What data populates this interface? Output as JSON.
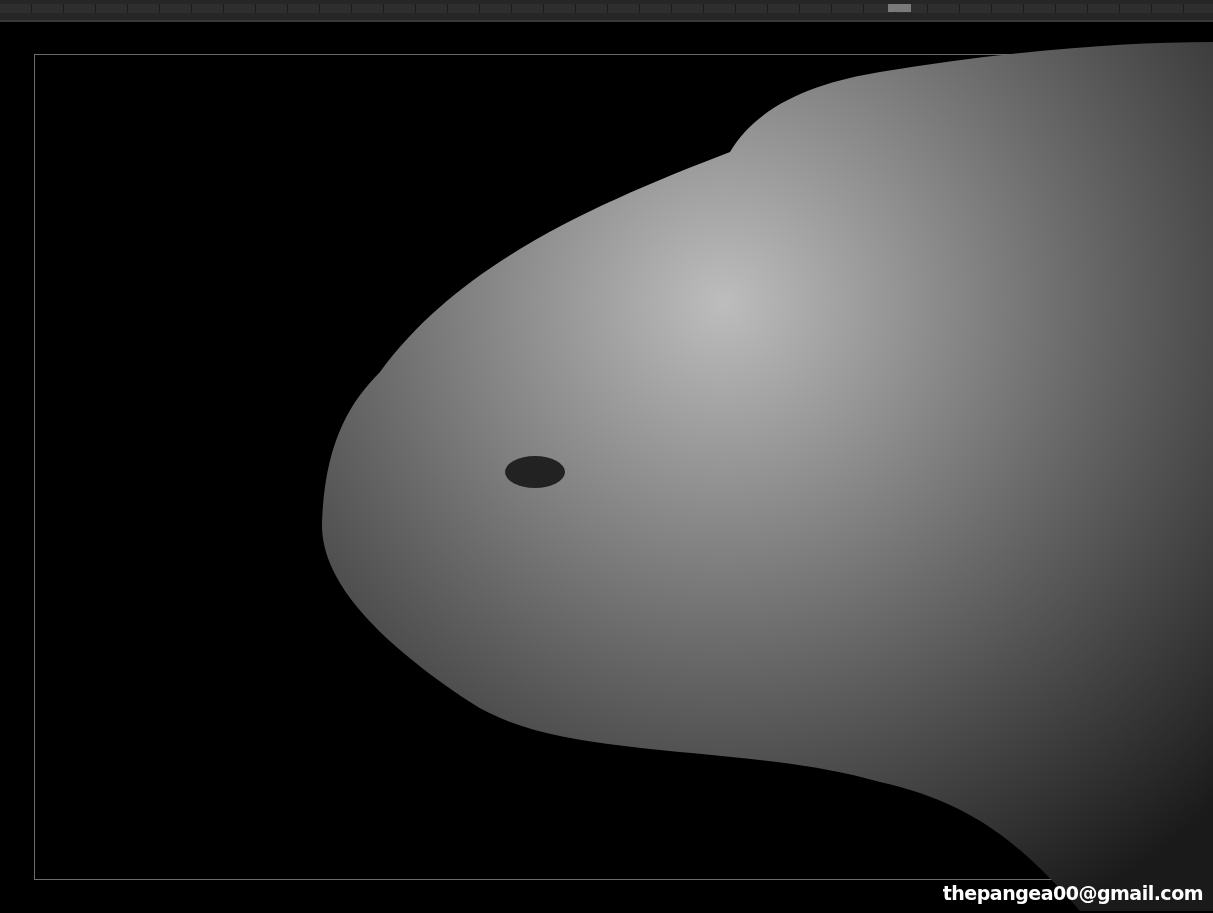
{
  "viewport": {
    "caption": "thepangea00@gmail.com"
  }
}
